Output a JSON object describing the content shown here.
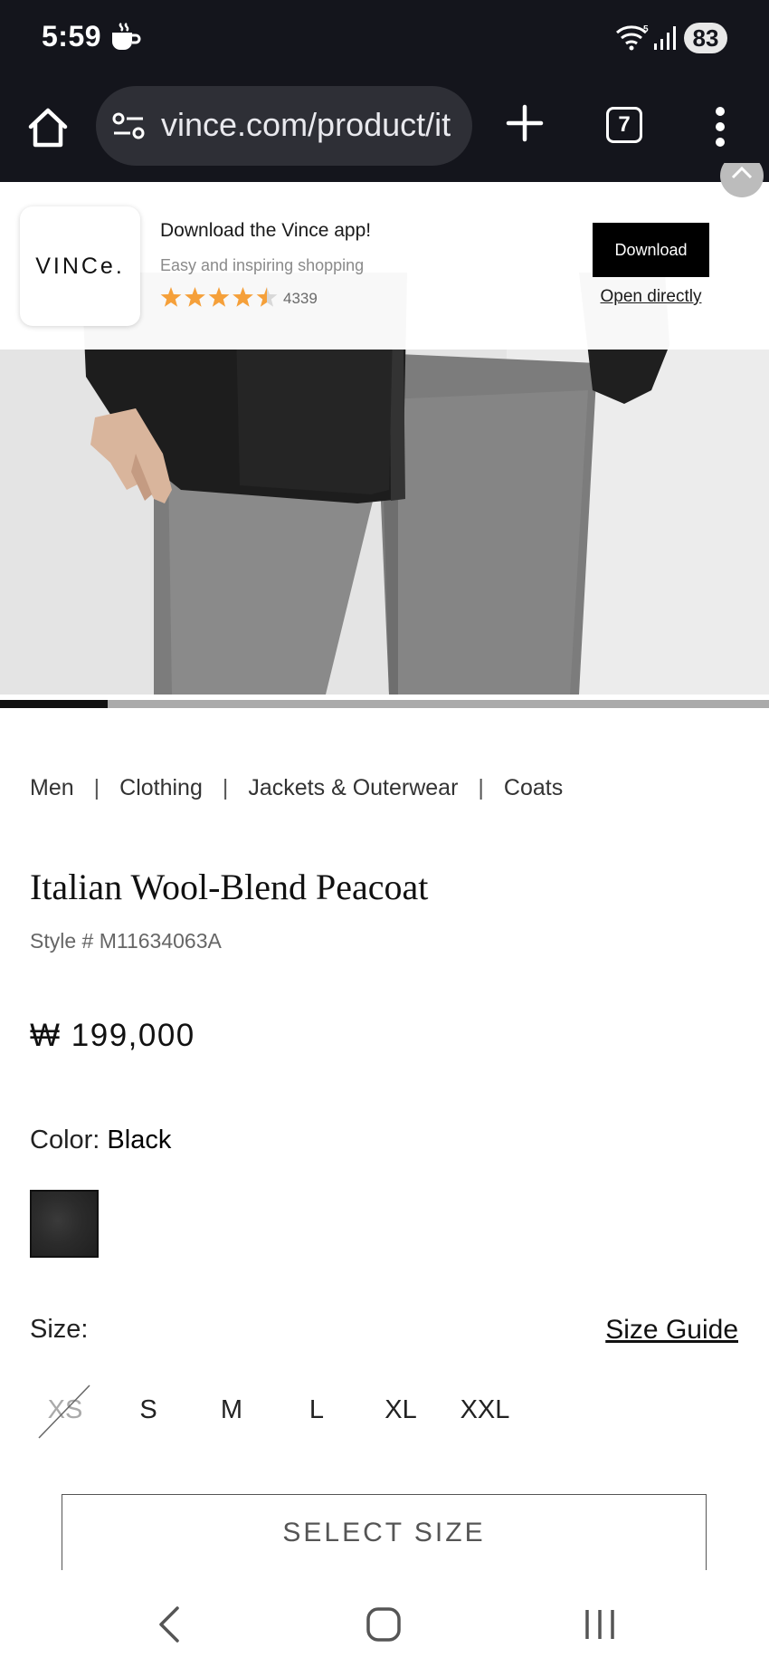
{
  "status_bar": {
    "time": "5:59",
    "battery": "83",
    "icons": [
      "coffee-cup-icon",
      "wifi-icon",
      "signal-icon"
    ]
  },
  "browser": {
    "url": "vince.com/product/it",
    "tab_count": "7",
    "icons": [
      "home-icon",
      "site-settings-icon",
      "new-tab-icon",
      "tabs-icon",
      "more-menu-icon"
    ]
  },
  "app_banner": {
    "logo_text": "VINCe.",
    "title": "Download the Vince app!",
    "subtitle": "Easy and inspiring shopping",
    "rating": 4.5,
    "rating_count": "4339",
    "download_label": "Download",
    "open_label": "Open directly",
    "star_color": "#f5a03a"
  },
  "gallery": {
    "progress": 0.14
  },
  "breadcrumb": {
    "items": [
      "Men",
      "Clothing",
      "Jackets & Outerwear",
      "Coats"
    ],
    "separator": "|"
  },
  "product": {
    "title": "Italian Wool-Blend Peacoat",
    "style_number": "Style # M11634063A",
    "price": "₩ 199,000",
    "color_label": "Color:",
    "color_value": "Black",
    "size_label": "Size:",
    "size_guide": "Size Guide",
    "sizes": [
      {
        "label": "XS",
        "available": false
      },
      {
        "label": "S",
        "available": true
      },
      {
        "label": "M",
        "available": true
      },
      {
        "label": "L",
        "available": true
      },
      {
        "label": "XL",
        "available": true
      },
      {
        "label": "XXL",
        "available": true
      }
    ],
    "select_size_label": "SELECT SIZE"
  },
  "system_nav": {
    "icons": [
      "back-icon",
      "home-nav-icon",
      "recent-apps-icon"
    ]
  }
}
